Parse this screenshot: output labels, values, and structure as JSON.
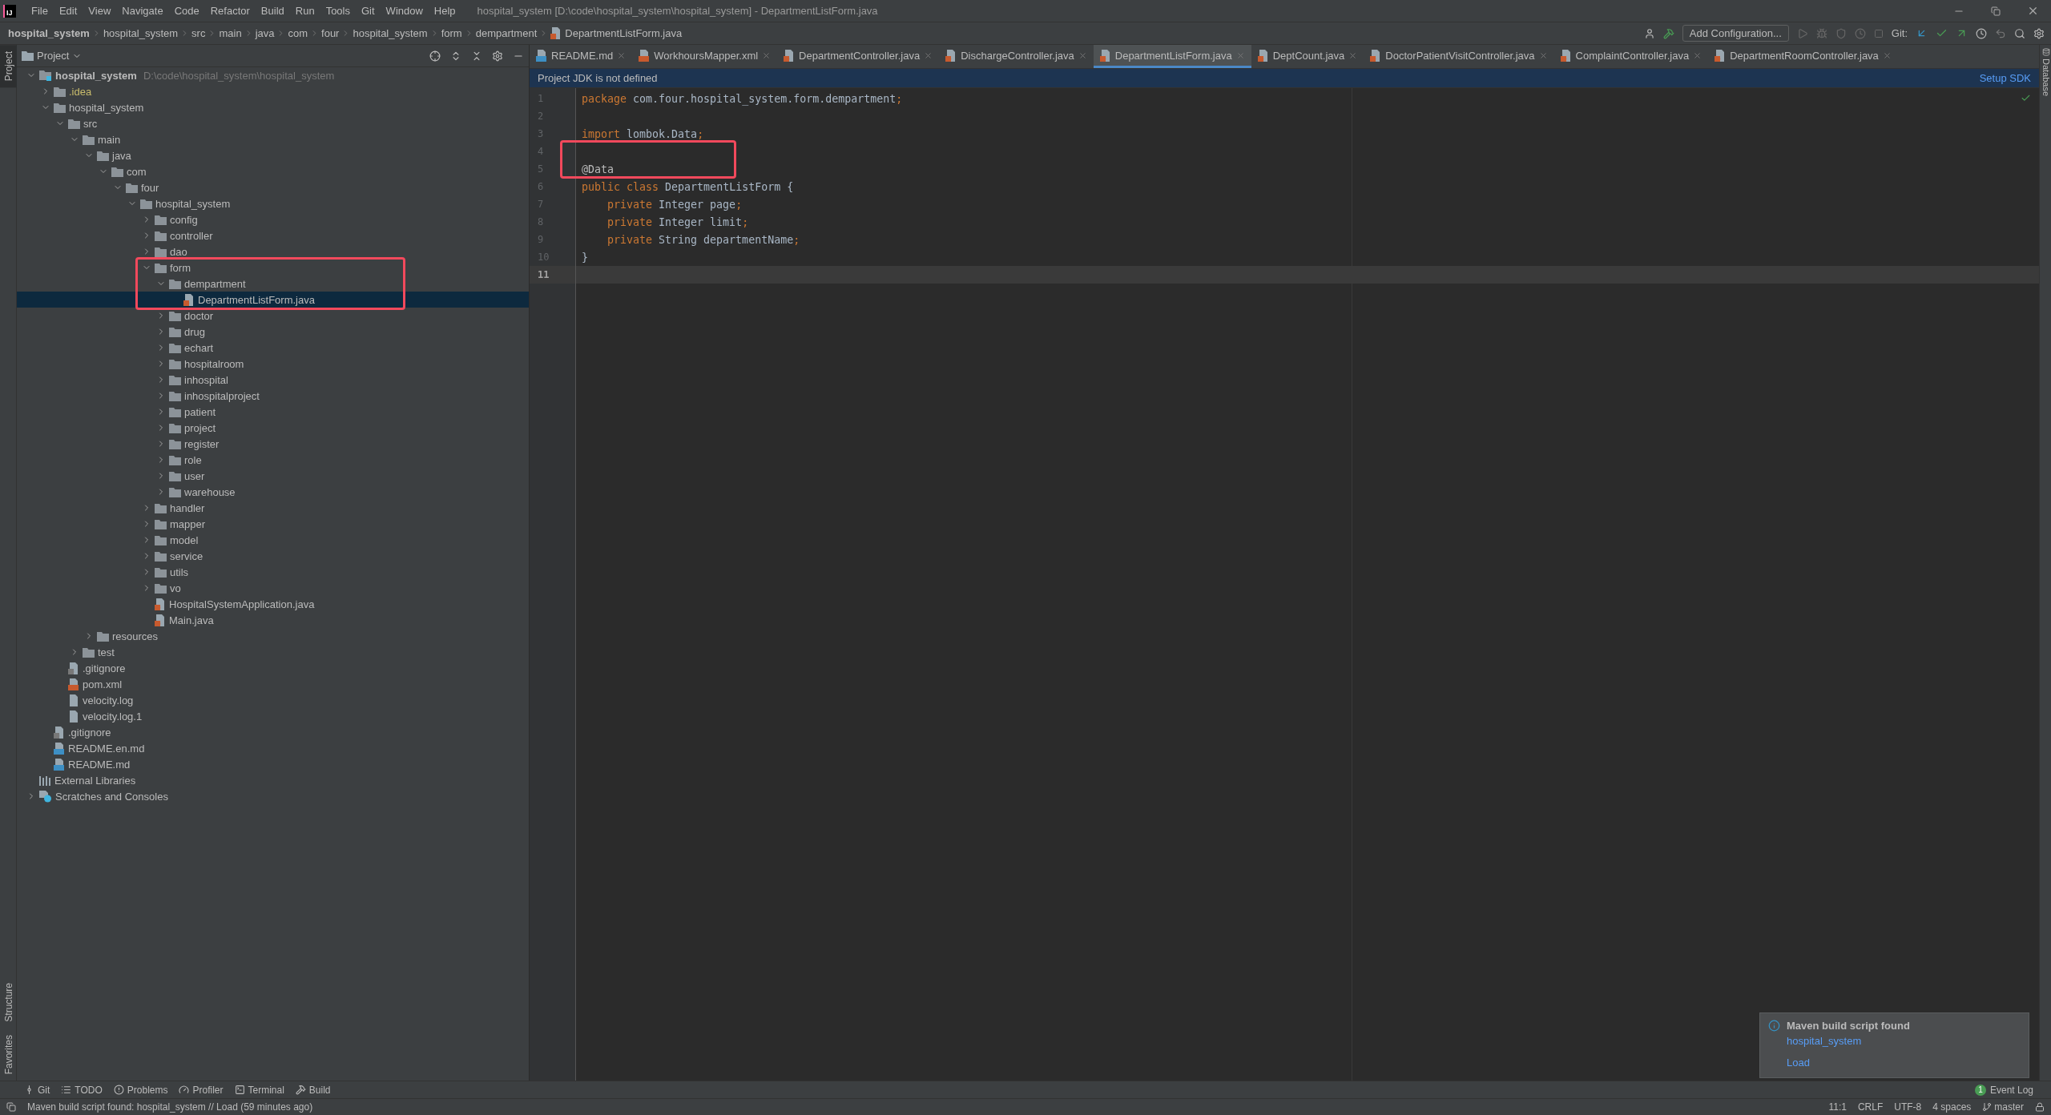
{
  "app": {
    "logo": "IJ",
    "menu": [
      "File",
      "Edit",
      "View",
      "Navigate",
      "Code",
      "Refactor",
      "Build",
      "Run",
      "Tools",
      "Git",
      "Window",
      "Help"
    ],
    "title": "hospital_system [D:\\code\\hospital_system\\hospital_system] - DepartmentListForm.java"
  },
  "breadcrumb": [
    {
      "label": "hospital_system",
      "kind": "project"
    },
    {
      "label": "hospital_system",
      "kind": "dir"
    },
    {
      "label": "src",
      "kind": "dir"
    },
    {
      "label": "main",
      "kind": "dir"
    },
    {
      "label": "java",
      "kind": "dir"
    },
    {
      "label": "com",
      "kind": "dir"
    },
    {
      "label": "four",
      "kind": "dir"
    },
    {
      "label": "hospital_system",
      "kind": "dir"
    },
    {
      "label": "form",
      "kind": "dir"
    },
    {
      "label": "dempartment",
      "kind": "dir"
    },
    {
      "label": "DepartmentListForm.java",
      "kind": "java"
    }
  ],
  "toolbar": {
    "run_configuration": "Add Configuration...",
    "vcs_label": "Git:"
  },
  "left_strip": [
    {
      "label": "Project",
      "kind": "top",
      "selected": true
    },
    {
      "label": "Structure",
      "kind": "bottom",
      "selected": false
    },
    {
      "label": "Favorites",
      "kind": "bottom",
      "selected": false
    }
  ],
  "right_strip": [
    {
      "label": "Database"
    }
  ],
  "project_panel": {
    "title": "Project",
    "tree": [
      {
        "label": "hospital_system",
        "kind": "root",
        "hint": "D:\\code\\hospital_system\\hospital_system",
        "selected": false,
        "expanded": true,
        "children": [
          {
            "label": ".idea",
            "kind": "idea",
            "selected": false,
            "expanded": false
          },
          {
            "label": "hospital_system",
            "kind": "folder",
            "selected": false,
            "expanded": true,
            "children": [
              {
                "label": "src",
                "kind": "folder",
                "selected": false,
                "expanded": true,
                "children": [
                  {
                    "label": "main",
                    "kind": "folder",
                    "selected": false,
                    "expanded": true,
                    "children": [
                      {
                        "label": "java",
                        "kind": "folder",
                        "selected": false,
                        "expanded": true,
                        "children": [
                          {
                            "label": "com",
                            "kind": "folder",
                            "selected": false,
                            "expanded": true,
                            "children": [
                              {
                                "label": "four",
                                "kind": "folder",
                                "selected": false,
                                "expanded": true,
                                "children": [
                                  {
                                    "label": "hospital_system",
                                    "kind": "folder",
                                    "selected": false,
                                    "expanded": true,
                                    "children": [
                                      {
                                        "label": "config",
                                        "kind": "folder",
                                        "selected": false,
                                        "expanded": false
                                      },
                                      {
                                        "label": "controller",
                                        "kind": "folder",
                                        "selected": false,
                                        "expanded": false
                                      },
                                      {
                                        "label": "dao",
                                        "kind": "folder",
                                        "selected": false,
                                        "expanded": false
                                      },
                                      {
                                        "label": "form",
                                        "kind": "folder",
                                        "selected": false,
                                        "expanded": true,
                                        "boxed": true,
                                        "children": [
                                          {
                                            "label": "dempartment",
                                            "kind": "folder",
                                            "selected": false,
                                            "expanded": true,
                                            "boxed": true,
                                            "children": [
                                              {
                                                "label": "DepartmentListForm.java",
                                                "kind": "java",
                                                "selected": true,
                                                "boxed": true
                                              }
                                            ]
                                          },
                                          {
                                            "label": "doctor",
                                            "kind": "folder",
                                            "selected": false,
                                            "expanded": false
                                          },
                                          {
                                            "label": "drug",
                                            "kind": "folder",
                                            "selected": false,
                                            "expanded": false
                                          },
                                          {
                                            "label": "echart",
                                            "kind": "folder",
                                            "selected": false,
                                            "expanded": false
                                          },
                                          {
                                            "label": "hospitalroom",
                                            "kind": "folder",
                                            "selected": false,
                                            "expanded": false
                                          },
                                          {
                                            "label": "inhospital",
                                            "kind": "folder",
                                            "selected": false,
                                            "expanded": false
                                          },
                                          {
                                            "label": "inhospitalproject",
                                            "kind": "folder",
                                            "selected": false,
                                            "expanded": false
                                          },
                                          {
                                            "label": "patient",
                                            "kind": "folder",
                                            "selected": false,
                                            "expanded": false
                                          },
                                          {
                                            "label": "project",
                                            "kind": "folder",
                                            "selected": false,
                                            "expanded": false
                                          },
                                          {
                                            "label": "register",
                                            "kind": "folder",
                                            "selected": false,
                                            "expanded": false
                                          },
                                          {
                                            "label": "role",
                                            "kind": "folder",
                                            "selected": false,
                                            "expanded": false
                                          },
                                          {
                                            "label": "user",
                                            "kind": "folder",
                                            "selected": false,
                                            "expanded": false
                                          },
                                          {
                                            "label": "warehouse",
                                            "kind": "folder",
                                            "selected": false,
                                            "expanded": false
                                          }
                                        ]
                                      },
                                      {
                                        "label": "handler",
                                        "kind": "folder",
                                        "selected": false,
                                        "expanded": false
                                      },
                                      {
                                        "label": "mapper",
                                        "kind": "folder",
                                        "selected": false,
                                        "expanded": false
                                      },
                                      {
                                        "label": "model",
                                        "kind": "folder",
                                        "selected": false,
                                        "expanded": false
                                      },
                                      {
                                        "label": "service",
                                        "kind": "folder",
                                        "selected": false,
                                        "expanded": false
                                      },
                                      {
                                        "label": "utils",
                                        "kind": "folder",
                                        "selected": false,
                                        "expanded": false
                                      },
                                      {
                                        "label": "vo",
                                        "kind": "folder",
                                        "selected": false,
                                        "expanded": false
                                      },
                                      {
                                        "label": "HospitalSystemApplication.java",
                                        "kind": "java",
                                        "selected": false
                                      },
                                      {
                                        "label": "Main.java",
                                        "kind": "java",
                                        "selected": false
                                      }
                                    ]
                                  }
                                ]
                              }
                            ]
                          }
                        ]
                      },
                      {
                        "label": "resources",
                        "kind": "folder",
                        "selected": false,
                        "expanded": false
                      }
                    ]
                  },
                  {
                    "label": "test",
                    "kind": "folder",
                    "selected": false,
                    "expanded": false
                  }
                ]
              },
              {
                "label": ".gitignore",
                "kind": "gitignore",
                "selected": false
              },
              {
                "label": "pom.xml",
                "kind": "xml",
                "selected": false
              },
              {
                "label": "velocity.log",
                "kind": "file",
                "selected": false
              },
              {
                "label": "velocity.log.1",
                "kind": "file",
                "selected": false
              }
            ]
          },
          {
            "label": ".gitignore",
            "kind": "gitignore",
            "selected": false
          },
          {
            "label": "README.en.md",
            "kind": "md",
            "selected": false
          },
          {
            "label": "README.md",
            "kind": "md",
            "selected": false
          }
        ]
      },
      {
        "label": "External Libraries",
        "kind": "libraries",
        "selected": false
      },
      {
        "label": "Scratches and Consoles",
        "kind": "scratches",
        "selected": false,
        "expanded": false
      }
    ]
  },
  "tabs": [
    {
      "label": "README.md",
      "kind": "md",
      "selected": false
    },
    {
      "label": "WorkhoursMapper.xml",
      "kind": "xml",
      "selected": false
    },
    {
      "label": "DepartmentController.java",
      "kind": "java",
      "selected": false
    },
    {
      "label": "DischargeController.java",
      "kind": "java",
      "selected": false
    },
    {
      "label": "DepartmentListForm.java",
      "kind": "java",
      "selected": true
    },
    {
      "label": "DeptCount.java",
      "kind": "java",
      "selected": false
    },
    {
      "label": "DoctorPatientVisitController.java",
      "kind": "java",
      "selected": false
    },
    {
      "label": "ComplaintController.java",
      "kind": "java",
      "selected": false
    },
    {
      "label": "DepartmentRoomController.java",
      "kind": "java",
      "selected": false
    }
  ],
  "banner": {
    "message": "Project JDK is not defined",
    "action": "Setup SDK"
  },
  "editor": {
    "lines": [
      {
        "number": "1",
        "tokens": [
          {
            "kind": "keyword",
            "text": "package"
          },
          {
            "kind": "plain",
            "text": " com.four.hospital_system.form.dempartment"
          },
          {
            "kind": "punct",
            "text": ";"
          }
        ]
      },
      {
        "number": "2"
      },
      {
        "number": "3",
        "tokens": [
          {
            "kind": "keyword",
            "text": "import"
          },
          {
            "kind": "plain",
            "text": " lombok.Data"
          },
          {
            "kind": "punct",
            "text": ";"
          }
        ]
      },
      {
        "number": "4",
        "boxed": true
      },
      {
        "number": "5",
        "boxed": true,
        "tokens": [
          {
            "kind": "annotation",
            "text": "@Data"
          }
        ]
      },
      {
        "number": "6",
        "tokens": [
          {
            "kind": "keyword",
            "text": "public class"
          },
          {
            "kind": "plain",
            "text": " DepartmentListForm {"
          }
        ]
      },
      {
        "number": "7",
        "indented": true,
        "tokens": [
          {
            "kind": "keyword",
            "text": "private"
          },
          {
            "kind": "plain",
            "text": " Integer page"
          },
          {
            "kind": "punct",
            "text": ";"
          }
        ]
      },
      {
        "number": "8",
        "indented": true,
        "tokens": [
          {
            "kind": "keyword",
            "text": "private"
          },
          {
            "kind": "plain",
            "text": " Integer limit"
          },
          {
            "kind": "punct",
            "text": ";"
          }
        ]
      },
      {
        "number": "9",
        "indented": true,
        "tokens": [
          {
            "kind": "keyword",
            "text": "private"
          },
          {
            "kind": "plain",
            "text": " String departmentName"
          },
          {
            "kind": "punct",
            "text": ";"
          }
        ]
      },
      {
        "number": "10",
        "tokens": [
          {
            "kind": "plain",
            "text": "}"
          }
        ]
      },
      {
        "number": "11",
        "current": true
      }
    ]
  },
  "notification": {
    "title": "Maven build script found",
    "links": [
      "hospital_system",
      "Load"
    ]
  },
  "tool_windows": [
    {
      "label": "Git",
      "kind": "git"
    },
    {
      "label": "TODO",
      "kind": "todo"
    },
    {
      "label": "Problems",
      "kind": "problems"
    },
    {
      "label": "Profiler",
      "kind": "profiler"
    },
    {
      "label": "Terminal",
      "kind": "terminal"
    },
    {
      "label": "Build",
      "kind": "build"
    }
  ],
  "event_log": {
    "label": "Event Log",
    "badge": "1"
  },
  "status": {
    "message": "Maven build script found: hospital_system // Load (59 minutes ago)",
    "items": [
      "11:1",
      "CRLF",
      "UTF-8",
      "4 spaces"
    ],
    "branch": "master"
  }
}
